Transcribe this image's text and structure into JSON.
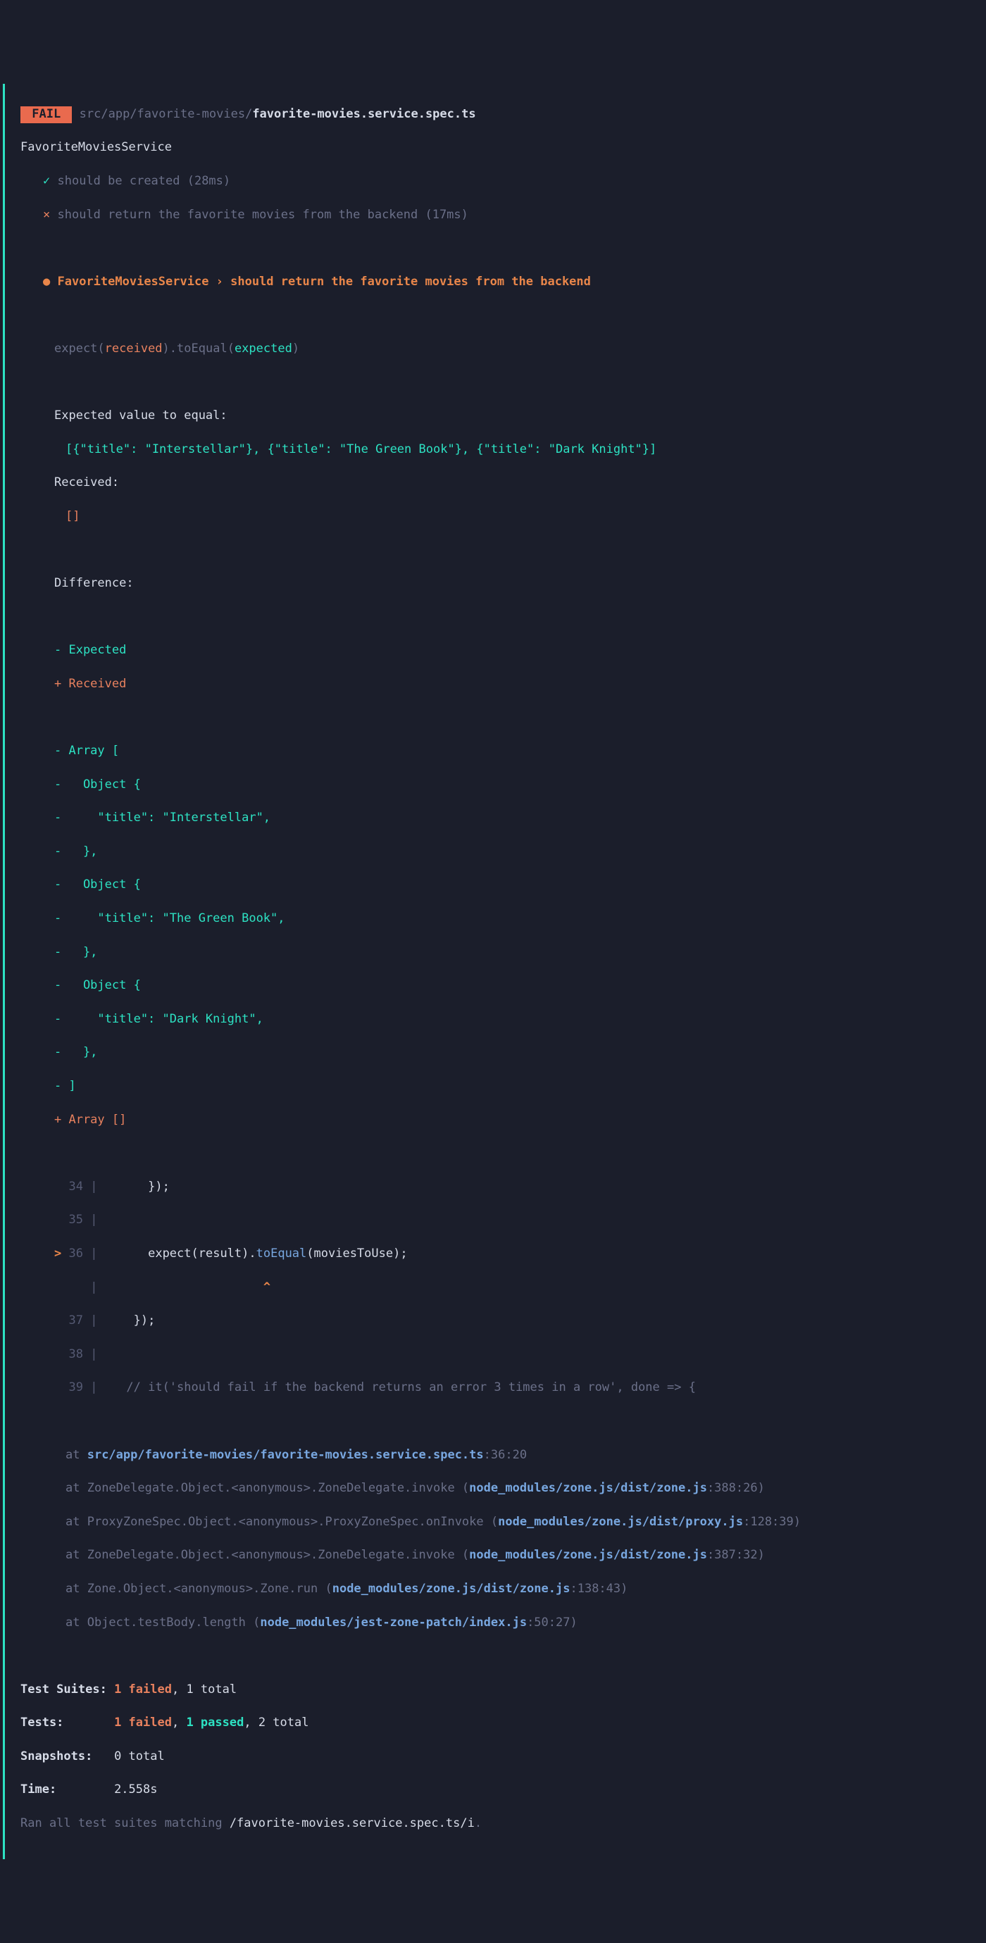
{
  "header": {
    "fail_badge": " FAIL ",
    "path_dim": "src/app/favorite-movies/",
    "path_file": "favorite-movies.service.spec.ts"
  },
  "suite": {
    "name": "FavoriteMoviesService",
    "tests": [
      {
        "mark": "✓",
        "text": "should be created (28ms)",
        "pass": true
      },
      {
        "mark": "×",
        "text": "should return the favorite movies from the backend (17ms)",
        "pass": false
      }
    ]
  },
  "failure": {
    "bullet": "●",
    "title": "FavoriteMoviesService › should return the favorite movies from the backend",
    "expect_line": {
      "prefix": "expect(",
      "received": "received",
      "mid1": ").",
      "toEqual": "toEqual",
      "open": "(",
      "expected": "expected",
      "close": ")"
    },
    "expected_header": "Expected value to equal:",
    "expected_value": "[{\"title\": \"Interstellar\"}, {\"title\": \"The Green Book\"}, {\"title\": \"Dark Knight\"}]",
    "received_header": "Received:",
    "received_value": "[]",
    "difference": "Difference:",
    "legend_expected": "- Expected",
    "legend_received": "+ Received",
    "diff_expected_lines": [
      "- Array [",
      "-   Object {",
      "-     \"title\": \"Interstellar\",",
      "-   },",
      "-   Object {",
      "-     \"title\": \"The Green Book\",",
      "-   },",
      "-   Object {",
      "-     \"title\": \"Dark Knight\",",
      "-   },",
      "- ]"
    ],
    "diff_received_line": "+ Array []"
  },
  "code": {
    "lines": [
      {
        "ptr": "  ",
        "num": "34",
        "pipe": " | ",
        "c1": "      });",
        "c2": ""
      },
      {
        "ptr": "  ",
        "num": "35",
        "pipe": " | ",
        "c1": "",
        "c2": ""
      },
      {
        "ptr": "> ",
        "num": "36",
        "pipe": " | ",
        "c1": "      expect(result).",
        "c2": "toEqual",
        "c3": "(moviesToUse)",
        "c4": ";"
      },
      {
        "ptr": "  ",
        "num": "  ",
        "pipe": " | ",
        "c1": "                      ",
        "caret": "^"
      },
      {
        "ptr": "  ",
        "num": "37",
        "pipe": " | ",
        "c1": "    });",
        "c2": ""
      },
      {
        "ptr": "  ",
        "num": "38",
        "pipe": " | ",
        "c1": "",
        "c2": ""
      },
      {
        "ptr": "  ",
        "num": "39",
        "pipe": " | ",
        "c1": "   // it('should fail if the backend returns an error 3 times in a row', done => {",
        "comment": true
      }
    ]
  },
  "stack": [
    {
      "at": "at ",
      "pre": "",
      "link": "src/app/favorite-movies/favorite-movies.service.spec.ts",
      "post": ":36:20",
      "close": ""
    },
    {
      "at": "at ",
      "pre": "ZoneDelegate.Object.<anonymous>.ZoneDelegate.invoke (",
      "link": "node_modules/zone.js/dist/zone.js",
      "post": ":388:26",
      "close": ")"
    },
    {
      "at": "at ",
      "pre": "ProxyZoneSpec.Object.<anonymous>.ProxyZoneSpec.onInvoke (",
      "link": "node_modules/zone.js/dist/proxy.js",
      "post": ":128:39",
      "close": ")"
    },
    {
      "at": "at ",
      "pre": "ZoneDelegate.Object.<anonymous>.ZoneDelegate.invoke (",
      "link": "node_modules/zone.js/dist/zone.js",
      "post": ":387:32",
      "close": ")"
    },
    {
      "at": "at ",
      "pre": "Zone.Object.<anonymous>.Zone.run (",
      "link": "node_modules/zone.js/dist/zone.js",
      "post": ":138:43",
      "close": ")"
    },
    {
      "at": "at ",
      "pre": "Object.testBody.length (",
      "link": "node_modules/jest-zone-patch/index.js",
      "post": ":50:27",
      "close": ")"
    }
  ],
  "summary": {
    "suites": {
      "label": "Test Suites: ",
      "failed": "1 failed",
      "sep": ", ",
      "total": "1 total"
    },
    "tests": {
      "label": "Tests:       ",
      "failed": "1 failed",
      "sep1": ", ",
      "passed": "1 passed",
      "sep2": ", ",
      "total": "2 total"
    },
    "snaps": {
      "label": "Snapshots:   ",
      "value": "0 total"
    },
    "time": {
      "label": "Time:        ",
      "value": "2.558s"
    },
    "ran": {
      "prefix": "Ran all test suites matching ",
      "pattern": "/favorite-movies.service.spec.ts/i",
      "suffix": "."
    }
  }
}
